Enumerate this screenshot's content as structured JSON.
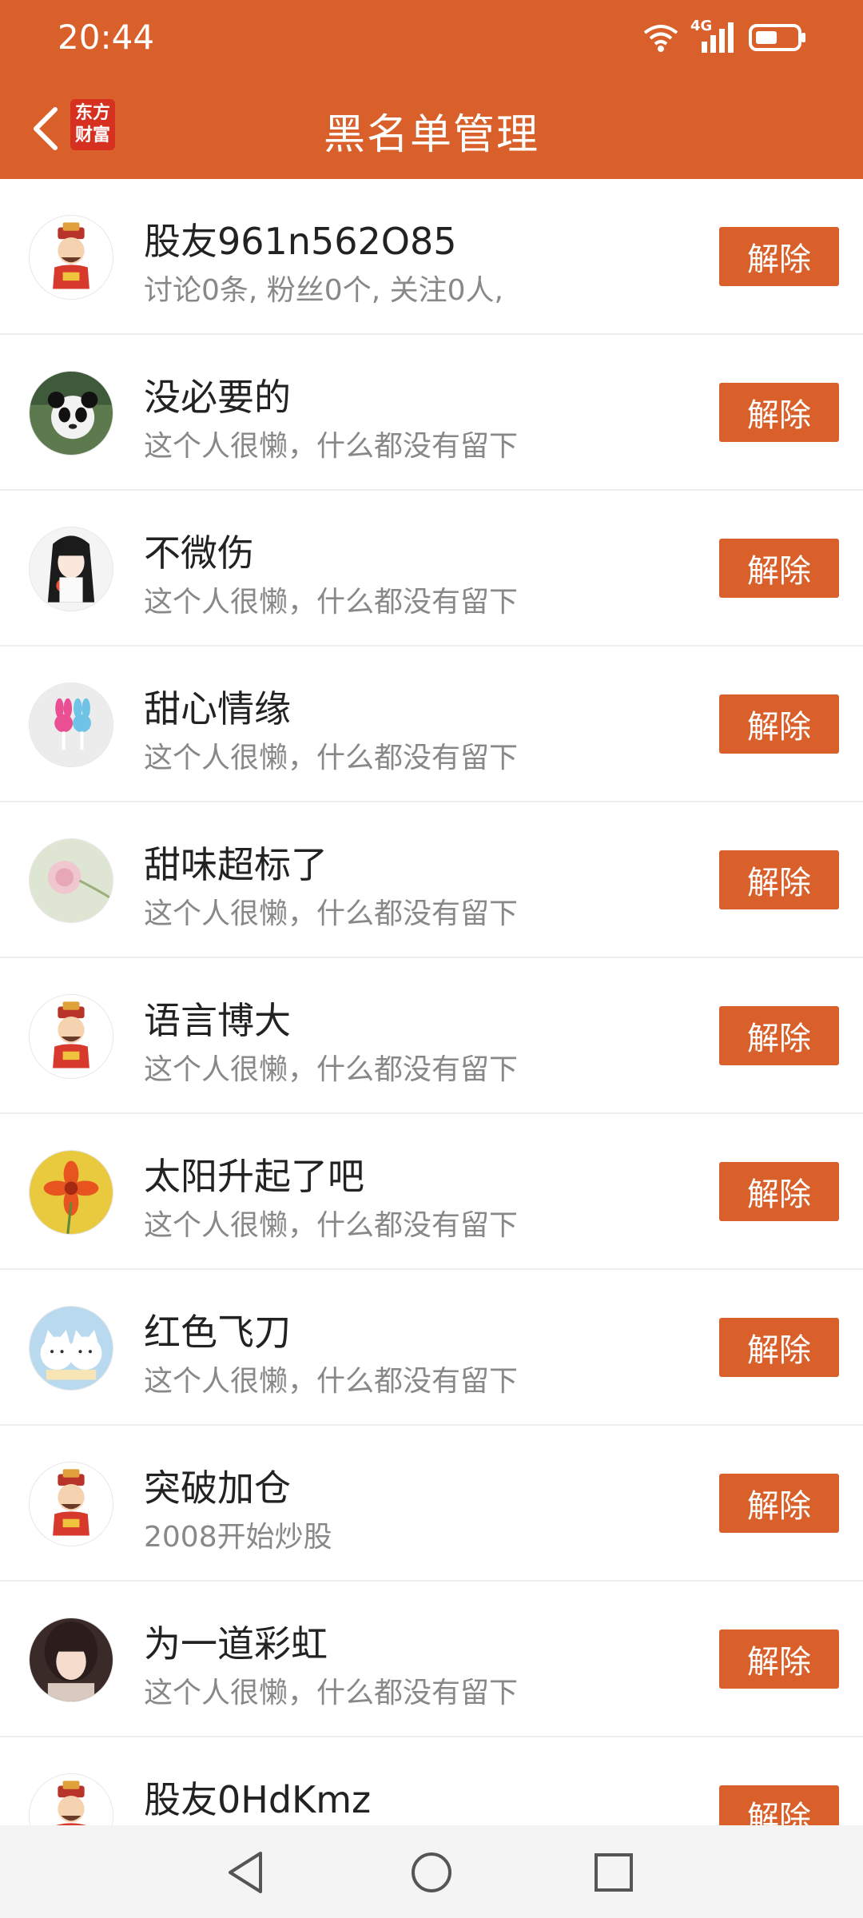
{
  "status_bar": {
    "time": "20:44",
    "network_label": "4G"
  },
  "header": {
    "title": "黑名单管理",
    "logo_line1": "东方",
    "logo_line2": "财富"
  },
  "button_label": "解除",
  "users": [
    {
      "name": "股友961n562O85",
      "desc": "讨论0条, 粉丝0个, 关注0人,",
      "avatar": "god-of-wealth-avatar"
    },
    {
      "name": "没必要的",
      "desc": "这个人很懒，什么都没有留下",
      "avatar": "panda-avatar"
    },
    {
      "name": "不微伤",
      "desc": "这个人很懒，什么都没有留下",
      "avatar": "anime-girl-avatar"
    },
    {
      "name": "甜心情缘",
      "desc": "这个人很懒，什么都没有留下",
      "avatar": "bunny-avatar"
    },
    {
      "name": "甜味超标了",
      "desc": "这个人很懒，什么都没有留下",
      "avatar": "flower-avatar"
    },
    {
      "name": "语言博大",
      "desc": "这个人很懒，什么都没有留下",
      "avatar": "god-of-wealth-avatar"
    },
    {
      "name": "太阳升起了吧",
      "desc": "这个人很懒，什么都没有留下",
      "avatar": "orange-flower-avatar"
    },
    {
      "name": "红色飞刀",
      "desc": "这个人很懒，什么都没有留下",
      "avatar": "cats-avatar"
    },
    {
      "name": "突破加仓",
      "desc": "2008开始炒股",
      "avatar": "god-of-wealth-avatar"
    },
    {
      "name": "为一道彩虹",
      "desc": "这个人很懒，什么都没有留下",
      "avatar": "girl-photo-avatar"
    },
    {
      "name": "股友0HdKmz",
      "desc": "",
      "avatar": "god-of-wealth-avatar"
    }
  ]
}
